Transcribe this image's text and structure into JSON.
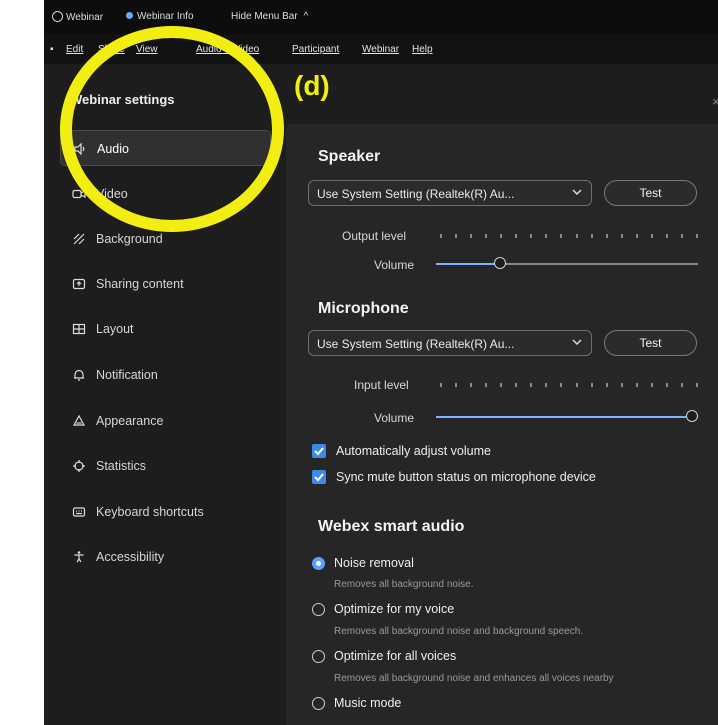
{
  "topbar": {
    "app_label": "Webinar",
    "info_label": "Webinar Info",
    "hide_menu_label": "Hide Menu Bar"
  },
  "menubar": {
    "items": [
      "Edit",
      "Share",
      "View",
      "Audio & Video",
      "Participant",
      "Webinar",
      "Help"
    ]
  },
  "sidebar": {
    "title": "Webinar settings",
    "items": [
      {
        "label": "Audio",
        "icon": "speaker-icon",
        "active": true
      },
      {
        "label": "Video",
        "icon": "video-icon"
      },
      {
        "label": "Background",
        "icon": "background-icon"
      },
      {
        "label": "Sharing content",
        "icon": "sharing-icon"
      },
      {
        "label": "Layout",
        "icon": "layout-icon"
      },
      {
        "label": "Notification",
        "icon": "bell-icon"
      },
      {
        "label": "Appearance",
        "icon": "appearance-icon"
      },
      {
        "label": "Statistics",
        "icon": "statistics-icon"
      },
      {
        "label": "Keyboard shortcuts",
        "icon": "keyboard-icon"
      },
      {
        "label": "Accessibility",
        "icon": "accessibility-icon"
      }
    ]
  },
  "speaker": {
    "title": "Speaker",
    "device": "Use System Setting (Realtek(R) Au...",
    "test_label": "Test",
    "output_label": "Output level",
    "volume_label": "Volume",
    "volume_value": 0.23
  },
  "microphone": {
    "title": "Microphone",
    "device": "Use System Setting (Realtek(R) Au...",
    "test_label": "Test",
    "input_label": "Input level",
    "volume_label": "Volume",
    "volume_value": 1.0
  },
  "checkboxes": {
    "auto_adjust": "Automatically adjust volume",
    "sync_mute": "Sync mute button status on microphone device"
  },
  "smart_audio": {
    "title": "Webex smart audio",
    "options": [
      {
        "label": "Noise removal",
        "desc": "Removes all background noise.",
        "selected": true
      },
      {
        "label": "Optimize for my voice",
        "desc": "Removes all background noise and background speech.",
        "selected": false
      },
      {
        "label": "Optimize for all voices",
        "desc": "Removes all background noise and enhances all voices nearby",
        "selected": false
      },
      {
        "label": "Music mode",
        "desc": "",
        "selected": false
      }
    ]
  },
  "annotation": {
    "label": "(d)"
  },
  "colors": {
    "accent": "#3c8be8",
    "annotation": "#f2ee12",
    "slider_fill": "#7fb2ff"
  }
}
